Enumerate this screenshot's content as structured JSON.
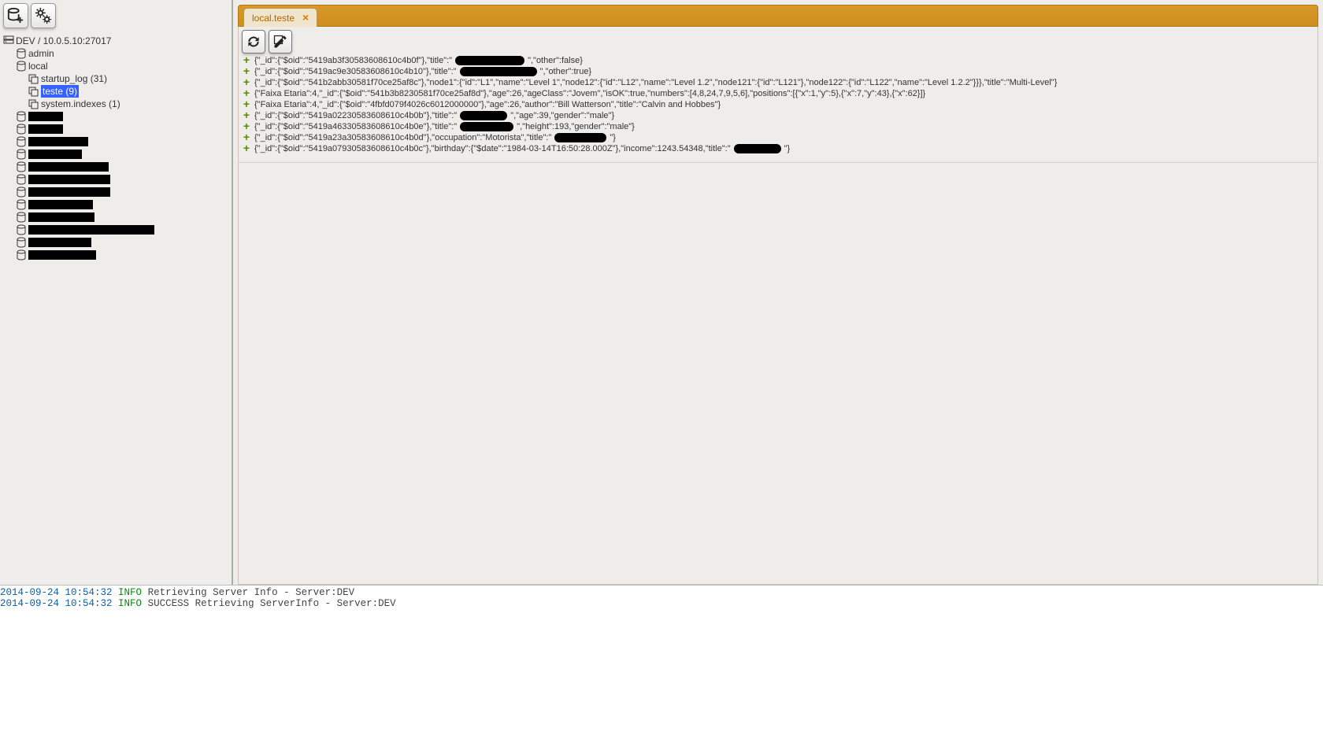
{
  "sidebar": {
    "root_label": "DEV / 10.0.5.10:27017",
    "dbs": [
      {
        "name": "admin"
      },
      {
        "name": "local",
        "collections": [
          {
            "label": "startup_log (31)",
            "selected": false
          },
          {
            "label": "teste (9)",
            "selected": true
          },
          {
            "label": "system.indexes (1)",
            "selected": false
          }
        ]
      }
    ],
    "redacted_widths": [
      44,
      44,
      76,
      68,
      102,
      104,
      104,
      82,
      84,
      160,
      80,
      86
    ]
  },
  "tab": {
    "label": "local.teste",
    "close": "×"
  },
  "documents": [
    {
      "pre": "{\"_id\":{\"$oid\":\"5419ab3f30583608610c4b0f\"},\"title\":\"",
      "pill": 88,
      "post": "\",\"other\":false}"
    },
    {
      "pre": "{\"_id\":{\"$oid\":\"5419ac9e30583608610c4b10\"},\"title\":\"",
      "pill": 98,
      "post": "\",\"other\":true}"
    },
    {
      "pre": "{\"_id\":{\"$oid\":\"541b2abb30581f70ce25af8c\"},\"node1\":{\"id\":\"L1\",\"name\":\"Level 1\",\"node12\":{\"id\":\"L12\",\"name\":\"Level 1.2\",\"node121\":{\"id\":\"L121\"},\"node122\":{\"id\":\"L122\",\"name\":\"Level 1.2.2\"}}},\"title\":\"Multi-Level\"}",
      "pill": 0,
      "post": ""
    },
    {
      "pre": "{\"Faixa Etaria\":4,\"_id\":{\"$oid\":\"541b3b8230581f70ce25af8d\"},\"age\":26,\"ageClass\":\"Jovem\",\"isOK\":true,\"numbers\":[4,8,24,7,9,5,6],\"positions\":[{\"x\":1,\"y\":5},{\"x\":7,\"y\":43},{\"x\":62}]}",
      "pill": 0,
      "post": ""
    },
    {
      "pre": "{\"Faixa Etaria\":4,\"_id\":{\"$oid\":\"4fbfd079f4026c6012000000\"},\"age\":26,\"author\":\"Bill Watterson\",\"title\":\"Calvin and Hobbes\"}",
      "pill": 0,
      "post": ""
    },
    {
      "pre": "{\"_id\":{\"$oid\":\"5419a02230583608610c4b0b\"},\"title\":\"",
      "pill": 60,
      "post": "\",\"age\":39,\"gender\":\"male\"}"
    },
    {
      "pre": "{\"_id\":{\"$oid\":\"5419a46330583608610c4b0e\"},\"title\":\"",
      "pill": 68,
      "post": "\",\"height\":193,\"gender\":\"male\"}"
    },
    {
      "pre": "{\"_id\":{\"$oid\":\"5419a23a30583608610c4b0d\"},\"occupation\":\"Motorista\",\"title\":\"",
      "pill": 66,
      "post": "\"}"
    },
    {
      "pre": "{\"_id\":{\"$oid\":\"5419a07930583608610c4b0c\"},\"birthday\":{\"$date\":\"1984-03-14T16:50:28.000Z\"},\"income\":1243.54348,\"title\":\"",
      "pill": 60,
      "post": "\"}"
    }
  ],
  "log": [
    {
      "ts": "2014-09-24 10:54:32",
      "lvl": "INFO",
      "msg": "Retrieving Server Info - Server:DEV"
    },
    {
      "ts": "2014-09-24 10:54:32",
      "lvl": "INFO",
      "msg": "SUCCESS Retrieving ServerInfo - Server:DEV"
    }
  ]
}
